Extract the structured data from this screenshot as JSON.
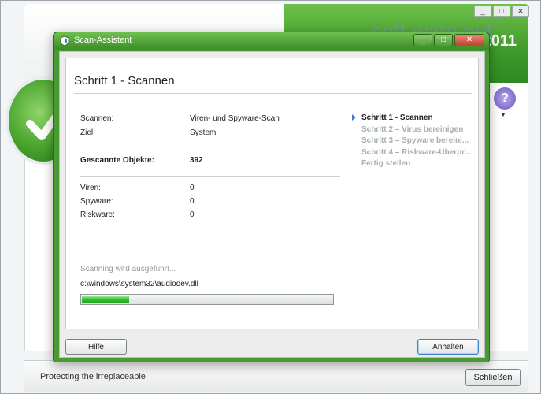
{
  "background_app": {
    "window_buttons": [
      "_",
      "□",
      "✕"
    ],
    "version_year": "2011",
    "help_symbol": "?",
    "statusbar": {
      "tagline": "Protecting the irreplaceable",
      "close_label": "Schließen"
    }
  },
  "watermark": {
    "brand": "soft-ware.net",
    "subtitle": "AKTUELLE DOWNLOADS"
  },
  "dialog": {
    "title": "Scan-Assistent",
    "titlebar_buttons": [
      "_",
      "□",
      "✕"
    ],
    "step_heading": "Schritt 1 - Scannen",
    "fields": {
      "scan_label": "Scannen:",
      "scan_value": "Viren- und Spyware-Scan",
      "target_label": "Ziel:",
      "target_value": "System",
      "scanned_label": "Gescannte Objekte:",
      "scanned_value": "392",
      "viruses_label": "Viren:",
      "viruses_value": "0",
      "spyware_label": "Spyware:",
      "spyware_value": "0",
      "riskware_label": "Riskware:",
      "riskware_value": "0"
    },
    "progress": {
      "status_text": "Scanning wird ausgeführt...",
      "current_file": "c:\\windows\\system32\\audiodev.dll",
      "fraction": 0.19
    },
    "steps": [
      {
        "label": "Schritt 1 - Scannen",
        "active": true
      },
      {
        "label": "Schritt 2 – Virus bereinigen",
        "active": false
      },
      {
        "label": "Schritt 3 – Spyware bereini...",
        "active": false
      },
      {
        "label": "Schritt 4 – Riskware-Überpr...",
        "active": false
      },
      {
        "label": "Fertig stellen",
        "active": false
      }
    ],
    "buttons": {
      "help": "Hilfe",
      "stop": "Anhalten"
    }
  },
  "colors": {
    "accent_green": "#4a9a34",
    "progress_green": "#18a318",
    "step_arrow_blue": "#3f7dc8"
  }
}
